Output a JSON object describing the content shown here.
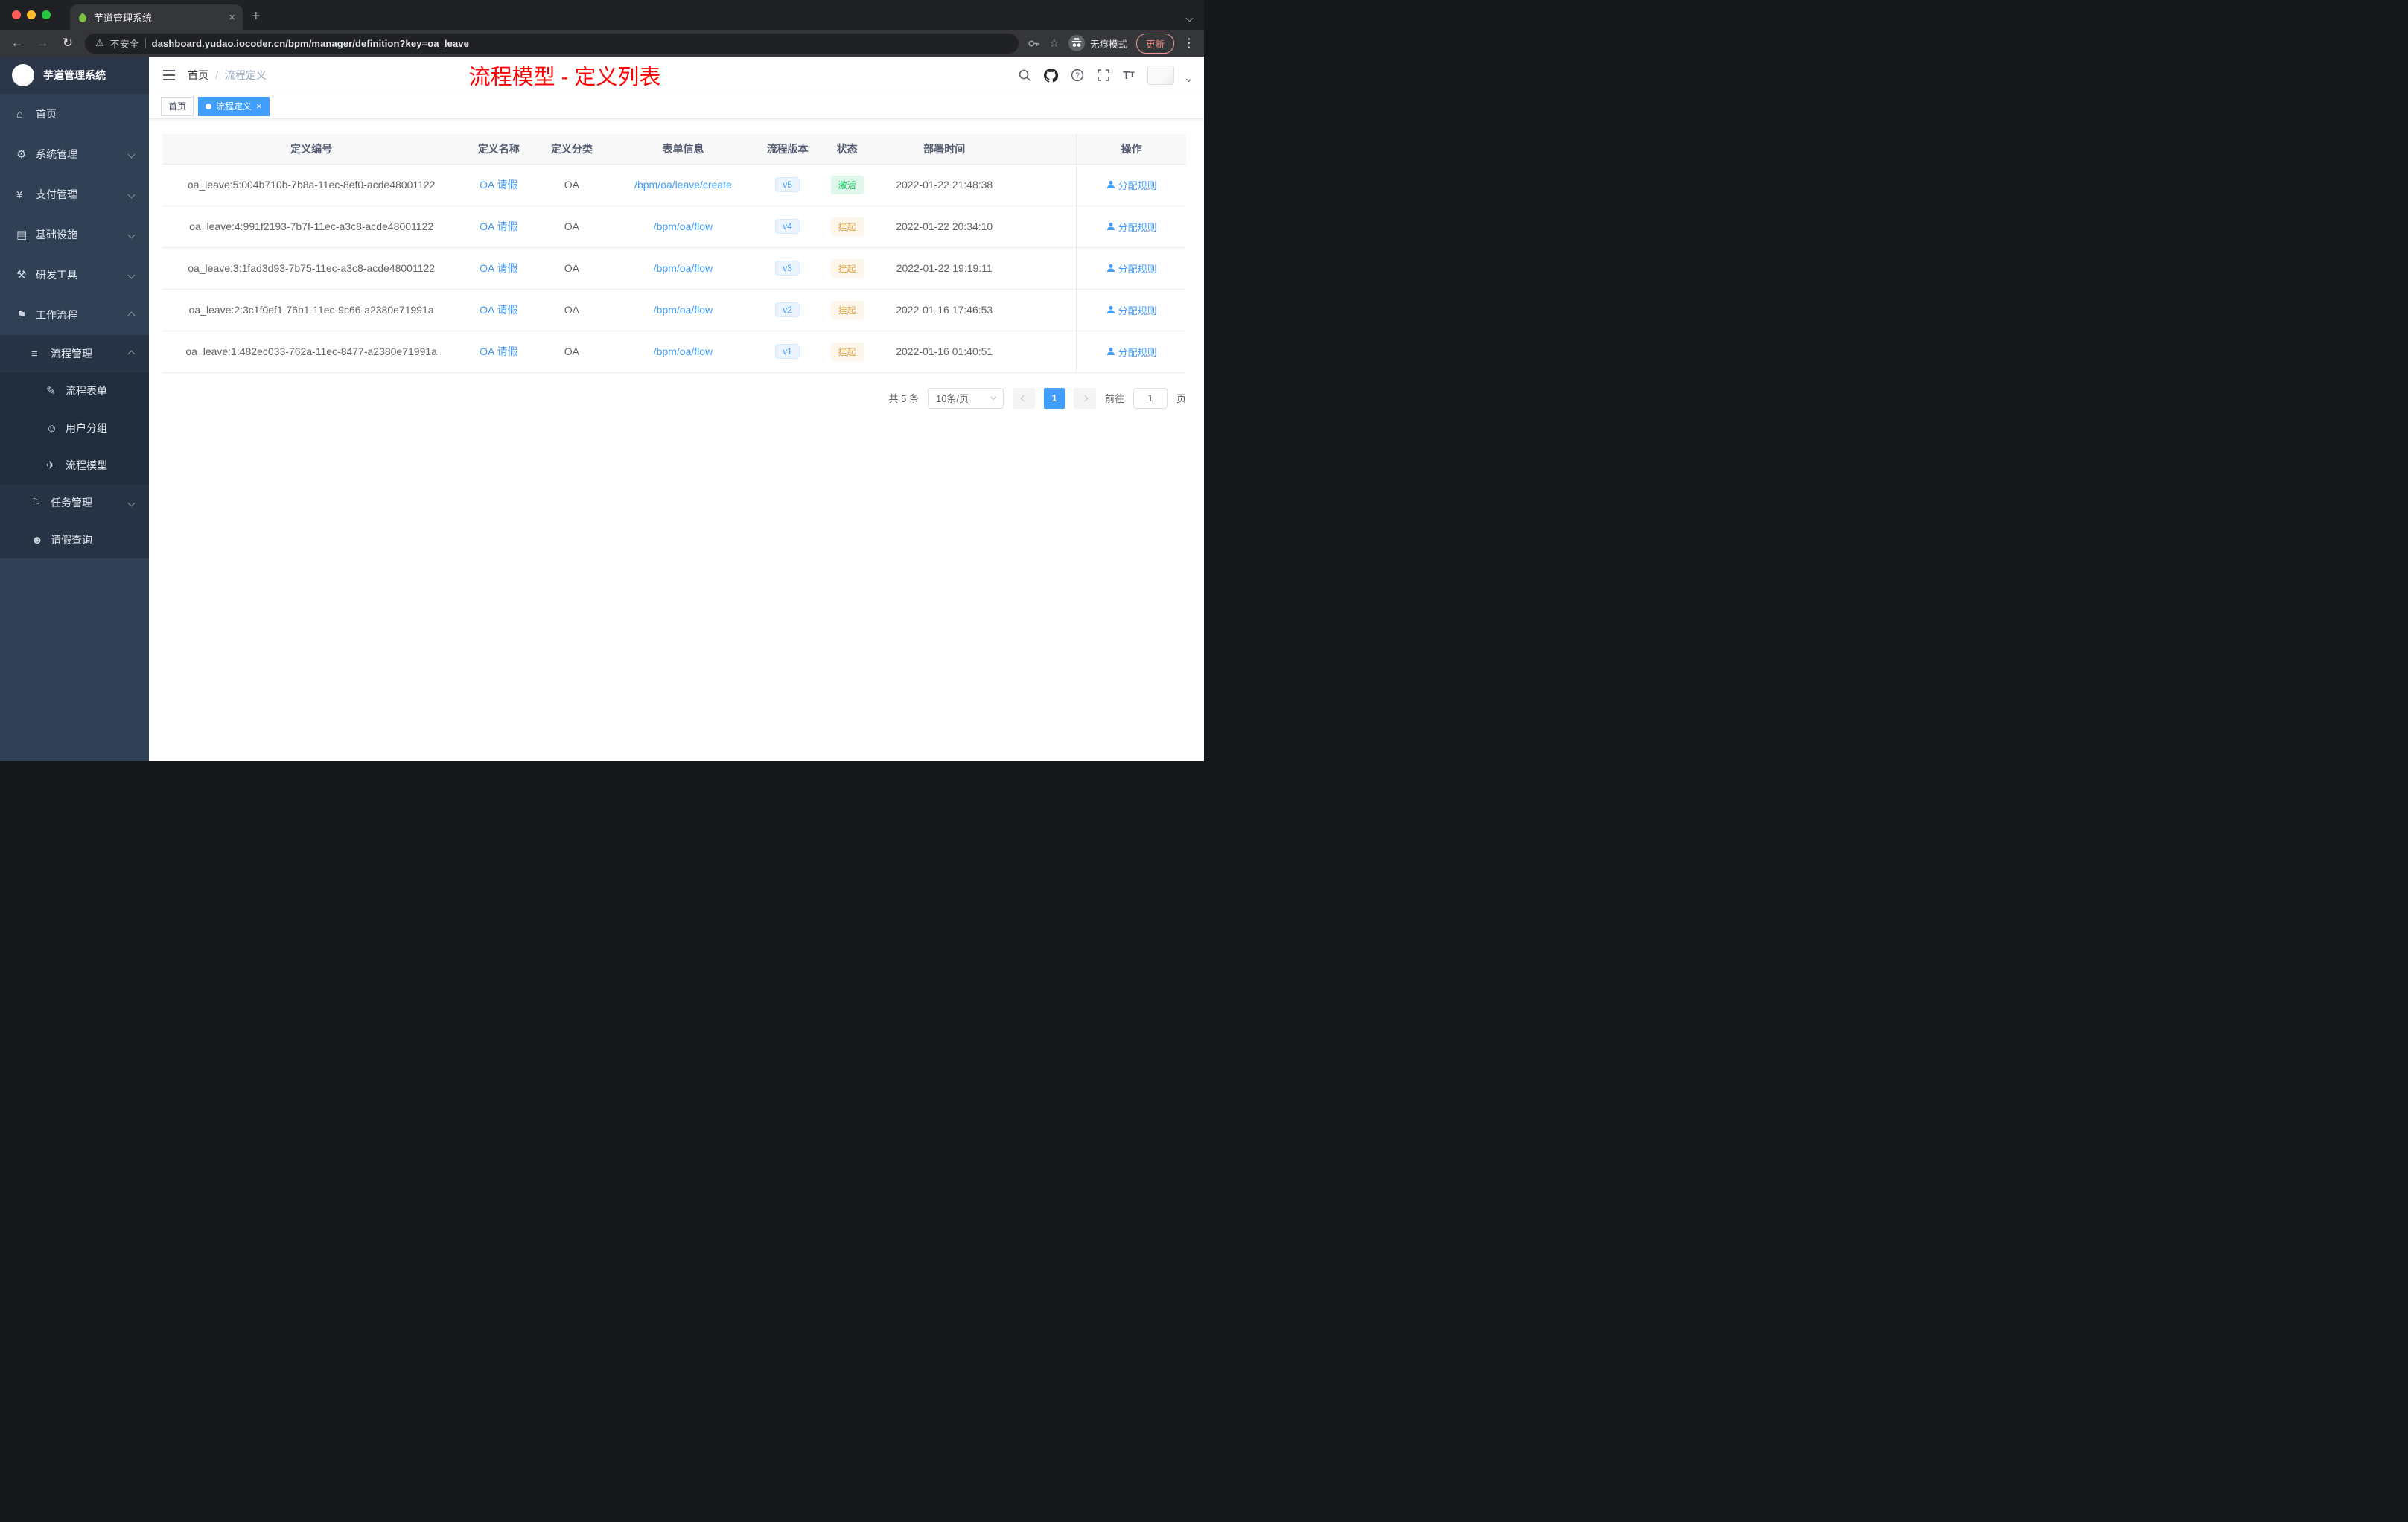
{
  "colors": {
    "accent": "#409eff",
    "title_red": "#ff0000",
    "sidebar_bg": "#304156",
    "submenu_bg": "#263445",
    "submenu_deep_bg": "#1f2d3d",
    "status_active_bg": "#e0f8ec",
    "status_active_text": "#13ce66",
    "status_suspend_bg": "#fdf6ec",
    "status_suspend_text": "#e6a23c",
    "version_bg": "#ecf5ff",
    "version_text": "#409eff"
  },
  "glyphs": {
    "back": "←",
    "forward": "→",
    "reload": "↻",
    "warning": "⚠",
    "star": "☆",
    "dots": "⋮",
    "close": "×",
    "plus": "+",
    "home": "⌂",
    "gear": "⚙",
    "yen": "¥",
    "infra": "▤",
    "tools": "⚒",
    "workflow": "⚑",
    "list": "≡",
    "form": "✎",
    "users": "☺",
    "send": "✈",
    "task": "⚐",
    "person": "☻",
    "font_big": "T",
    "font_small": "T"
  },
  "browser": {
    "tab_title": "芋道管理系统",
    "security_label": "不安全",
    "url": "dashboard.yudao.iocoder.cn/bpm/manager/definition?key=oa_leave",
    "incognito_label": "无痕模式",
    "update_label": "更新"
  },
  "sidebar": {
    "logo_title": "芋道管理系统",
    "items": [
      {
        "label": "首页",
        "level": 1
      },
      {
        "label": "系统管理",
        "level": 1,
        "state": "collapsed"
      },
      {
        "label": "支付管理",
        "level": 1,
        "state": "collapsed"
      },
      {
        "label": "基础设施",
        "level": 1,
        "state": "collapsed"
      },
      {
        "label": "研发工具",
        "level": 1,
        "state": "collapsed"
      },
      {
        "label": "工作流程",
        "level": 1,
        "state": "expanded"
      },
      {
        "label": "流程管理",
        "level": 2,
        "state": "expanded"
      },
      {
        "label": "流程表单",
        "level": 3
      },
      {
        "label": "用户分组",
        "level": 3
      },
      {
        "label": "流程模型",
        "level": 3
      },
      {
        "label": "任务管理",
        "level": 2,
        "state": "collapsed"
      },
      {
        "label": "请假查询",
        "level": 2
      }
    ]
  },
  "header": {
    "breadcrumb_home": "首页",
    "breadcrumb_sep": "/",
    "breadcrumb_current": "流程定义",
    "page_title": "流程模型 - 定义列表"
  },
  "tags": [
    {
      "label": "首页",
      "active": false
    },
    {
      "label": "流程定义",
      "active": true
    }
  ],
  "table": {
    "columns": [
      "定义编号",
      "定义名称",
      "定义分类",
      "表单信息",
      "流程版本",
      "状态",
      "部署时间",
      "操作"
    ],
    "rows": [
      {
        "id": "oa_leave:5:004b710b-7b8a-11ec-8ef0-acde48001122",
        "name": "OA 请假",
        "category": "OA",
        "form": "/bpm/oa/leave/create",
        "version": "v5",
        "status": "激活",
        "status_type": "active",
        "deploy_time": "2022-01-22 21:48:38",
        "action": "分配规则"
      },
      {
        "id": "oa_leave:4:991f2193-7b7f-11ec-a3c8-acde48001122",
        "name": "OA 请假",
        "category": "OA",
        "form": "/bpm/oa/flow",
        "version": "v4",
        "status": "挂起",
        "status_type": "suspend",
        "deploy_time": "2022-01-22 20:34:10",
        "action": "分配规则"
      },
      {
        "id": "oa_leave:3:1fad3d93-7b75-11ec-a3c8-acde48001122",
        "name": "OA 请假",
        "category": "OA",
        "form": "/bpm/oa/flow",
        "version": "v3",
        "status": "挂起",
        "status_type": "suspend",
        "deploy_time": "2022-01-22 19:19:11",
        "action": "分配规则"
      },
      {
        "id": "oa_leave:2:3c1f0ef1-76b1-11ec-9c66-a2380e71991a",
        "name": "OA 请假",
        "category": "OA",
        "form": "/bpm/oa/flow",
        "version": "v2",
        "status": "挂起",
        "status_type": "suspend",
        "deploy_time": "2022-01-16 17:46:53",
        "action": "分配规则"
      },
      {
        "id": "oa_leave:1:482ec033-762a-11ec-8477-a2380e71991a",
        "name": "OA 请假",
        "category": "OA",
        "form": "/bpm/oa/flow",
        "version": "v1",
        "status": "挂起",
        "status_type": "suspend",
        "deploy_time": "2022-01-16 01:40:51",
        "action": "分配规则"
      }
    ]
  },
  "pagination": {
    "total": "共 5 条",
    "page_size": "10条/页",
    "current_page": "1",
    "goto_label": "前往",
    "goto_value": "1",
    "page_unit": "页"
  }
}
